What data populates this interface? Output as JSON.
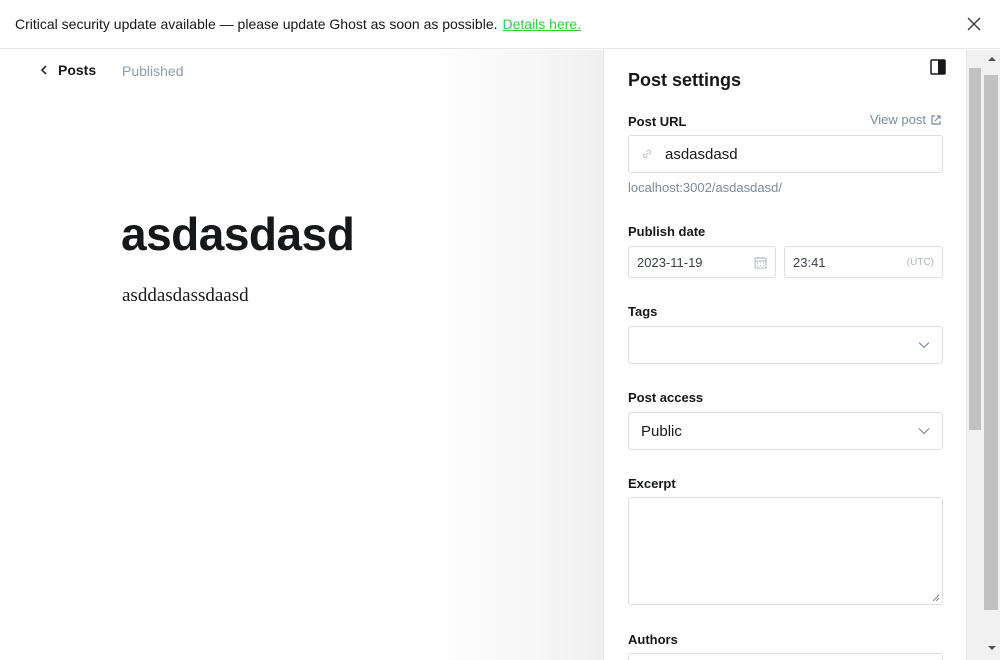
{
  "banner": {
    "message": "Critical security update available — please update Ghost as soon as possible.",
    "link_text": "Details here."
  },
  "editor": {
    "back_label": "Posts",
    "status": "Published",
    "title": "asdasdasd",
    "body": "asddasdassdaasd"
  },
  "settings": {
    "title": "Post settings",
    "post_url_label": "Post URL",
    "view_post_label": "View post",
    "url_slug": "asdasdasd",
    "url_hint": "localhost:3002/asdasdasd/",
    "publish_date_label": "Publish date",
    "date_value": "2023-11-19",
    "time_value": "23:41",
    "timezone": "(UTC)",
    "tags_label": "Tags",
    "tags_value": "",
    "post_access_label": "Post access",
    "post_access_value": "Public",
    "excerpt_label": "Excerpt",
    "excerpt_value": "",
    "authors_label": "Authors"
  },
  "colors": {
    "accent_link": "#30cf43",
    "muted_text": "#7c8b9a",
    "border": "#dddee0"
  },
  "icons": {
    "banner_close": "close-icon",
    "back": "chevron-left-icon",
    "panel_toggle": "sidebar-toggle-icon",
    "view_post": "external-link-icon",
    "url": "link-icon",
    "date": "calendar-icon",
    "select": "chevron-down-icon"
  }
}
